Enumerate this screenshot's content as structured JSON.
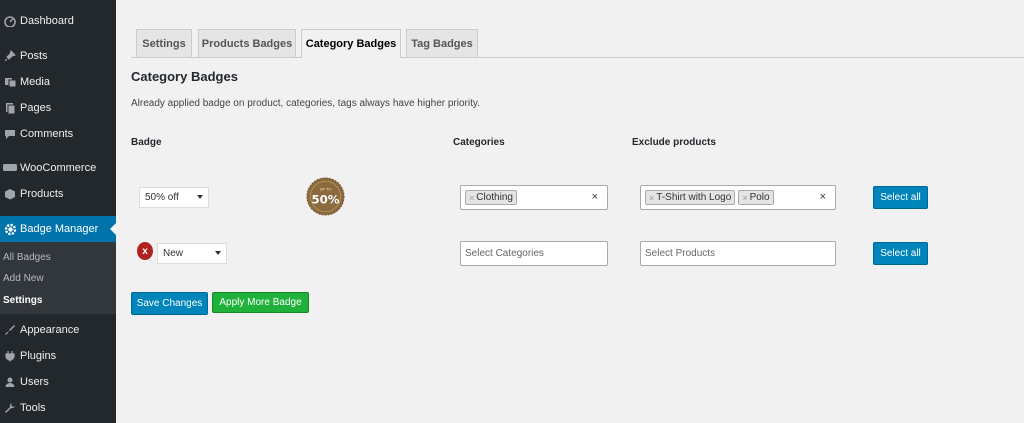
{
  "sidebar": {
    "items": [
      {
        "label": "Dashboard",
        "icon": "dashboard-icon"
      },
      {
        "label": "Posts",
        "icon": "pin-icon"
      },
      {
        "label": "Media",
        "icon": "media-icon"
      },
      {
        "label": "Pages",
        "icon": "pages-icon"
      },
      {
        "label": "Comments",
        "icon": "comment-icon"
      },
      {
        "label": "WooCommerce",
        "icon": "woo-icon"
      },
      {
        "label": "Products",
        "icon": "box-icon"
      },
      {
        "label": "Badge Manager",
        "icon": "gear-icon"
      },
      {
        "label": "Appearance",
        "icon": "brush-icon"
      },
      {
        "label": "Plugins",
        "icon": "plug-icon"
      },
      {
        "label": "Users",
        "icon": "user-icon"
      },
      {
        "label": "Tools",
        "icon": "wrench-icon"
      }
    ],
    "submenu": [
      "All Badges",
      "Add New",
      "Settings"
    ]
  },
  "tabs": [
    "Settings",
    "Products Badges",
    "Category Badges",
    "Tag Badges"
  ],
  "heading": "Category Badges",
  "description": "Already applied badge on product, categories, tags always have higher priority.",
  "columns": {
    "badge": "Badge",
    "categories": "Categories",
    "exclude": "Exclude products"
  },
  "rows": [
    {
      "badge": "50% off",
      "badge_image_text": {
        "top": "UP TO",
        "main": "50%"
      },
      "categories": [
        "Clothing"
      ],
      "exclude": [
        "T-Shirt with Logo",
        "Polo"
      ],
      "select_all": "Select all"
    },
    {
      "remove": "x",
      "badge": "New",
      "categories_placeholder": "Select Categories",
      "exclude_placeholder": "Select Products",
      "select_all": "Select all"
    }
  ],
  "buttons": {
    "save": "Save Changes",
    "apply": "Apply More Badge"
  },
  "colors": {
    "sidebar": "#23282d",
    "accent": "#0073aa",
    "primary_button": "#0085ba",
    "green_button": "#1fb139",
    "badge_brown": "#8b6a3e",
    "remove_red": "#b22222"
  }
}
